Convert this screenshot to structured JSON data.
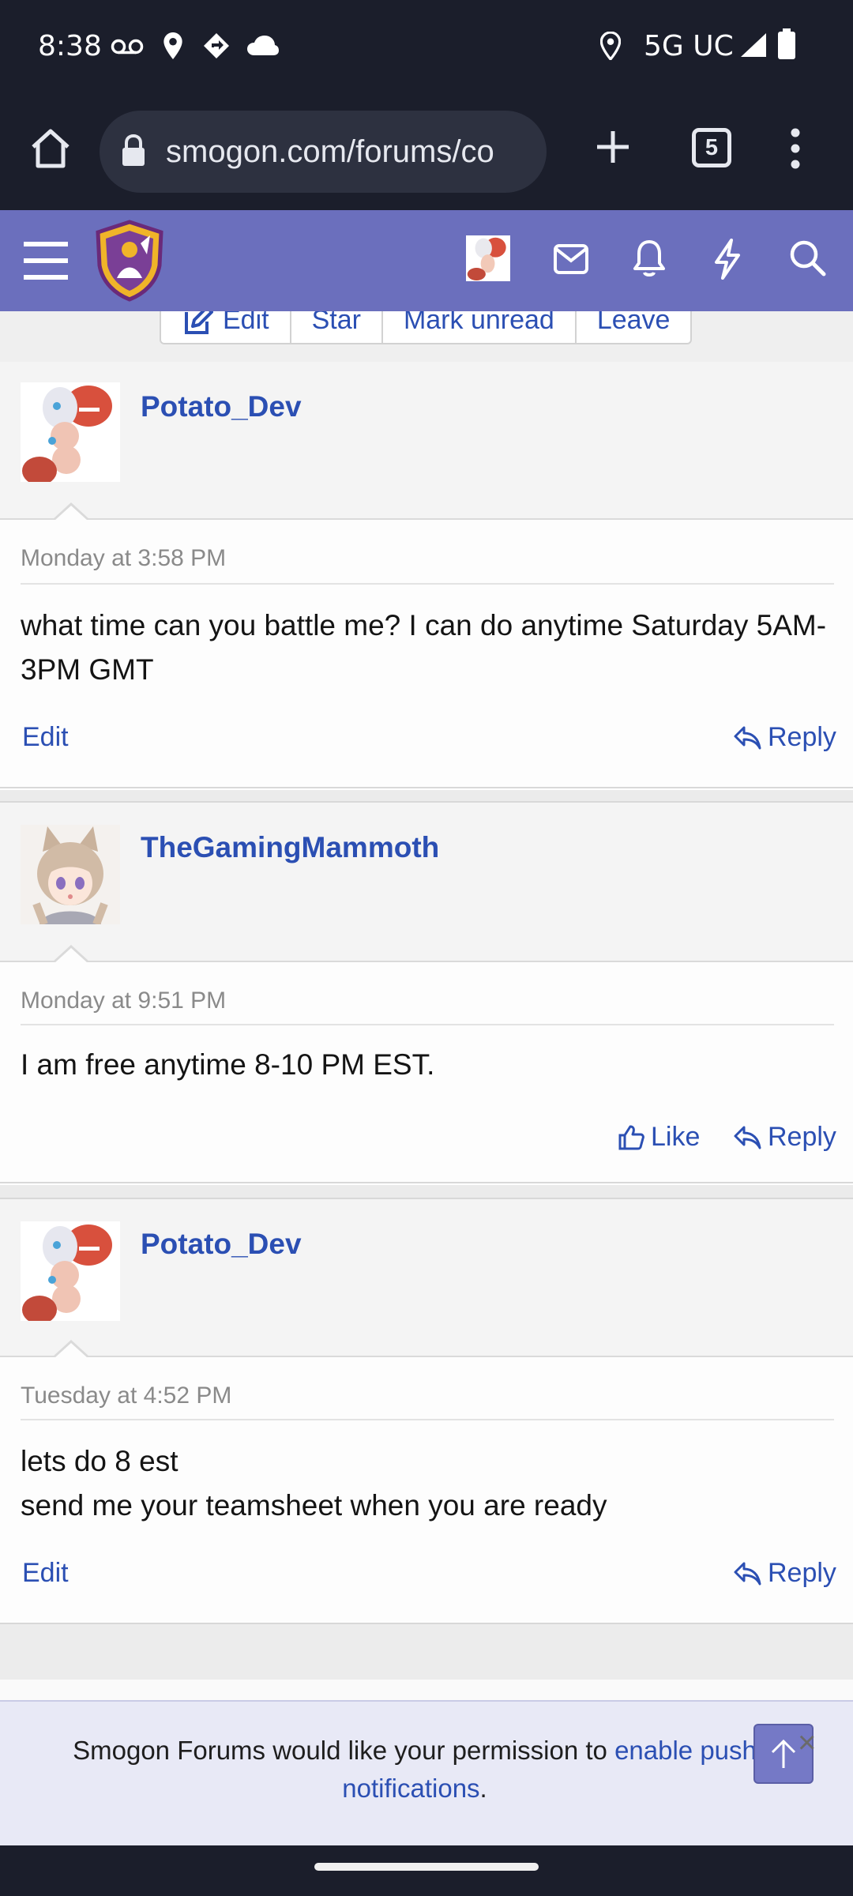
{
  "status_bar": {
    "time": "8:38",
    "network": "5G UC"
  },
  "browser": {
    "url": "smogon.com/forums/co",
    "tab_count": "5"
  },
  "thread_actions": {
    "edit": "Edit",
    "star": "Star",
    "mark_unread": "Mark unread",
    "leave": "Leave"
  },
  "posts": [
    {
      "username": "Potato_Dev",
      "timestamp": "Monday at 3:58 PM",
      "message": "what time can you battle me? I can do anytime Saturday 5AM-3PM GMT",
      "edit_label": "Edit",
      "reply_label": "Reply"
    },
    {
      "username": "TheGamingMammoth",
      "timestamp": "Monday at 9:51 PM",
      "message": "I am free anytime 8-10 PM EST.",
      "like_label": "Like",
      "reply_label": "Reply"
    },
    {
      "username": "Potato_Dev",
      "timestamp": "Tuesday at 4:52 PM",
      "message_line1": "lets do 8 est",
      "message_line2": "send me your teamsheet when you are ready",
      "edit_label": "Edit",
      "reply_label": "Reply"
    }
  ],
  "notice": {
    "text_before": "Smogon Forums would like your permission to ",
    "link_text": "enable push notifications",
    "text_after": ".",
    "close_label": "×"
  },
  "colors": {
    "header": "#6b6fbd",
    "link": "#2b4fb3",
    "system_bar": "#1b1e2b"
  },
  "icons": [
    "voicemail-icon",
    "location-icon",
    "signal-icon",
    "cloud-icon",
    "battery-icon",
    "home-icon",
    "lock-icon",
    "new-tab-icon",
    "tabs-icon",
    "menu-icon",
    "hamburger-icon",
    "site-logo",
    "inbox-icon",
    "bell-icon",
    "bolt-icon",
    "search-icon",
    "edit-icon",
    "reply-icon",
    "like-icon",
    "arrow-up-icon"
  ]
}
